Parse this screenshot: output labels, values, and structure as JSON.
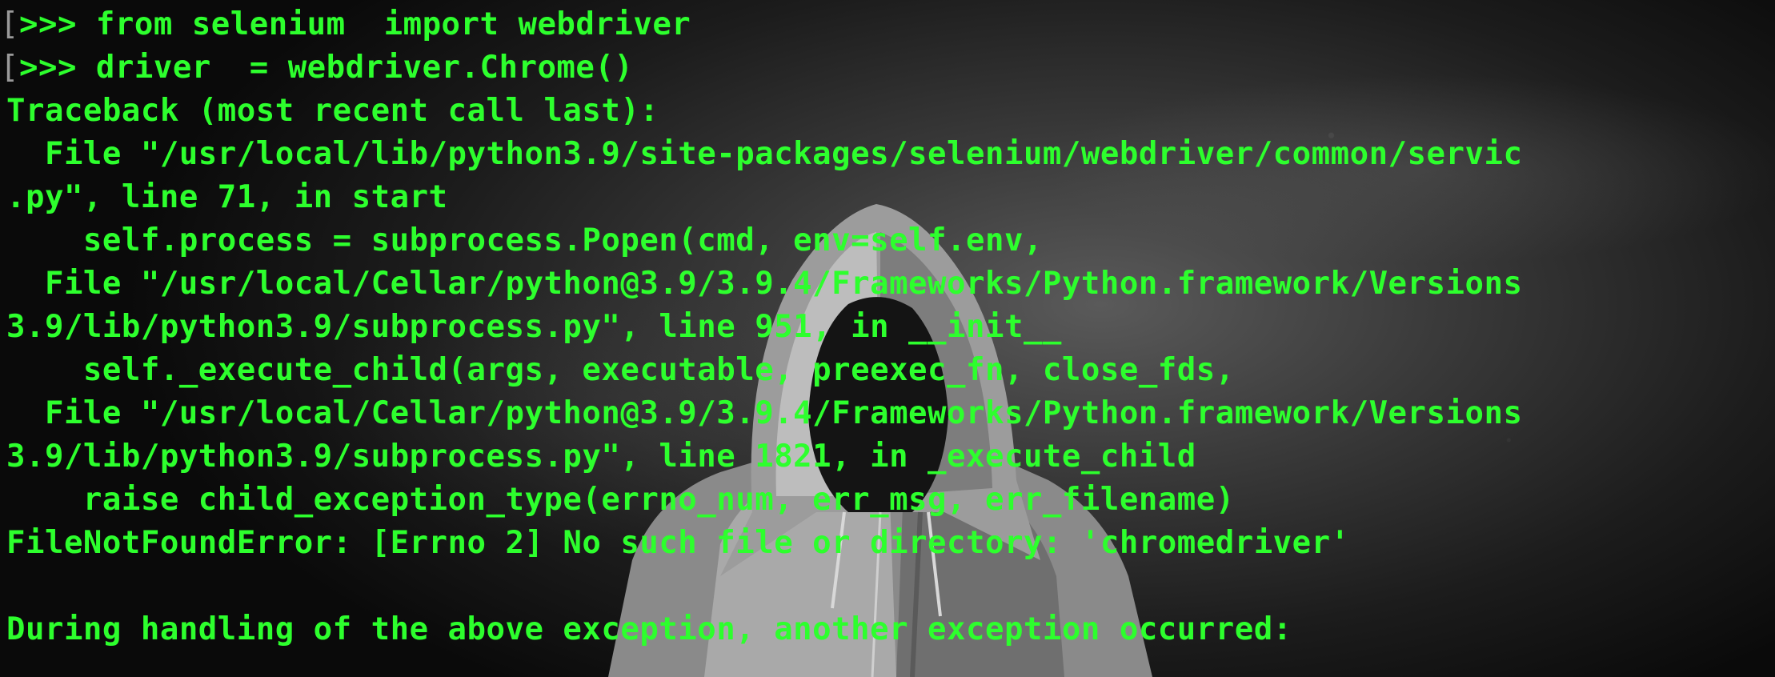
{
  "terminal": {
    "lines": [
      ">>> from selenium  import webdriver",
      ">>> driver  = webdriver.Chrome()",
      "Traceback (most recent call last):",
      "  File \"/usr/local/lib/python3.9/site-packages/selenium/webdriver/common/servic",
      ".py\", line 71, in start",
      "    self.process = subprocess.Popen(cmd, env=self.env,",
      "  File \"/usr/local/Cellar/python@3.9/3.9.4/Frameworks/Python.framework/Versions",
      "3.9/lib/python3.9/subprocess.py\", line 951, in __init__",
      "    self._execute_child(args, executable, preexec_fn, close_fds,",
      "  File \"/usr/local/Cellar/python@3.9/3.9.4/Frameworks/Python.framework/Versions",
      "3.9/lib/python3.9/subprocess.py\", line 1821, in _execute_child",
      "    raise child_exception_type(errno_num, err_msg, err_filename)",
      "FileNotFoundError: [Errno 2] No such file or directory: 'chromedriver'",
      "",
      "During handling of the above exception, another exception occurred:"
    ],
    "prompt_marker": "[",
    "text_color": "#2dff2d"
  },
  "background": {
    "image_subject": "hooded-figure"
  }
}
